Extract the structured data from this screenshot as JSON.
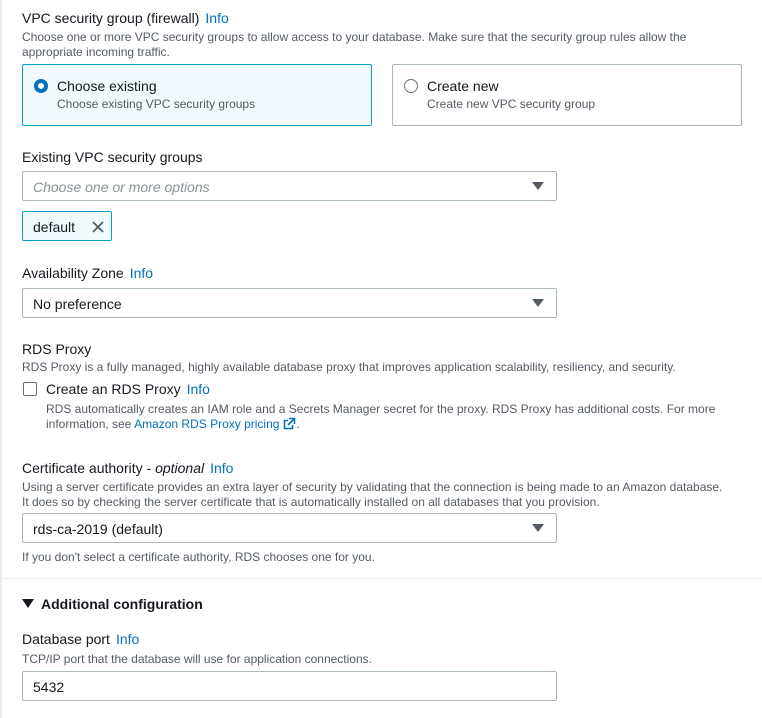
{
  "vpc_sg": {
    "title": "VPC security group (firewall)",
    "info": "Info",
    "description": "Choose one or more VPC security groups to allow access to your database. Make sure that the security group rules allow the appropriate incoming traffic.",
    "options": [
      {
        "title": "Choose existing",
        "desc": "Choose existing VPC security groups",
        "selected": true
      },
      {
        "title": "Create new",
        "desc": "Create new VPC security group",
        "selected": false
      }
    ]
  },
  "existing_sg": {
    "label": "Existing VPC security groups",
    "placeholder": "Choose one or more options",
    "tokens": [
      "default"
    ]
  },
  "az": {
    "label": "Availability Zone",
    "info": "Info",
    "value": "No preference"
  },
  "rds_proxy": {
    "title": "RDS Proxy",
    "description": "RDS Proxy is a fully managed, highly available database proxy that improves application scalability, resiliency, and security.",
    "checkbox_label": "Create an RDS Proxy",
    "info": "Info",
    "checked": false,
    "checkbox_desc_1": "RDS automatically creates an IAM role and a Secrets Manager secret for the proxy. RDS Proxy has additional costs. For more",
    "checkbox_desc_2_prefix": "information, see ",
    "pricing_link": "Amazon RDS Proxy pricing",
    "checkbox_desc_2_suffix": "."
  },
  "cert": {
    "label": "Certificate authority",
    "optional": "optional",
    "info": "Info",
    "description_1": "Using a server certificate provides an extra layer of security by validating that the connection is being made to an Amazon database.",
    "description_2": "It does so by checking the server certificate that is automatically installed on all databases that you provision.",
    "value": "rds-ca-2019 (default)",
    "hint": "If you don't select a certificate authority, RDS chooses one for you."
  },
  "additional": {
    "title": "Additional configuration",
    "expanded": true
  },
  "db_port": {
    "label": "Database port",
    "info": "Info",
    "description": "TCP/IP port that the database will use for application connections.",
    "value": "5432"
  },
  "colors": {
    "link": "#0073bb",
    "selected_border": "#00a1c9",
    "selected_bg": "#f1faff",
    "text": "#16191f",
    "muted": "#545b64"
  },
  "icons": [
    "radio-selected-icon",
    "radio-unselected-icon",
    "chevron-down-icon",
    "close-icon",
    "checkbox-icon",
    "external-link-icon",
    "caret-down-icon"
  ]
}
